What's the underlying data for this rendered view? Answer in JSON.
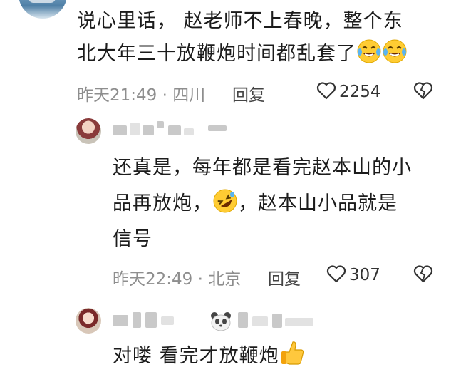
{
  "comment_main": {
    "line1": "说心里话， 赵老师不上春晚，整个东",
    "line2": "北大年三十放鞭炮时间都乱套了",
    "time": "昨天21:49",
    "separator": "·",
    "location": "四川",
    "reply_label": "回复",
    "like_count": "2254"
  },
  "reply_1": {
    "line1": "还真是，每年都是看完赵本山的小",
    "line2a": "品再放炮，",
    "line2b": "，赵本山小品就是",
    "line3": "信号",
    "time": "昨天22:49",
    "separator": "·",
    "location": "北京",
    "reply_label": "回复",
    "like_count": "307"
  },
  "reply_2": {
    "text": "对喽 看完才放鞭炮"
  },
  "icons": {
    "like": "heart-outline-icon",
    "dislike": "broken-heart-icon",
    "emoji_cry_laugh": "tears-of-joy-emoji",
    "emoji_rolling": "rolling-laughing-emoji",
    "emoji_thumbs": "thumbs-up-emoji"
  },
  "colors": {
    "text": "#1c1c1c",
    "meta": "#8e8e8e",
    "background": "#ffffff"
  }
}
